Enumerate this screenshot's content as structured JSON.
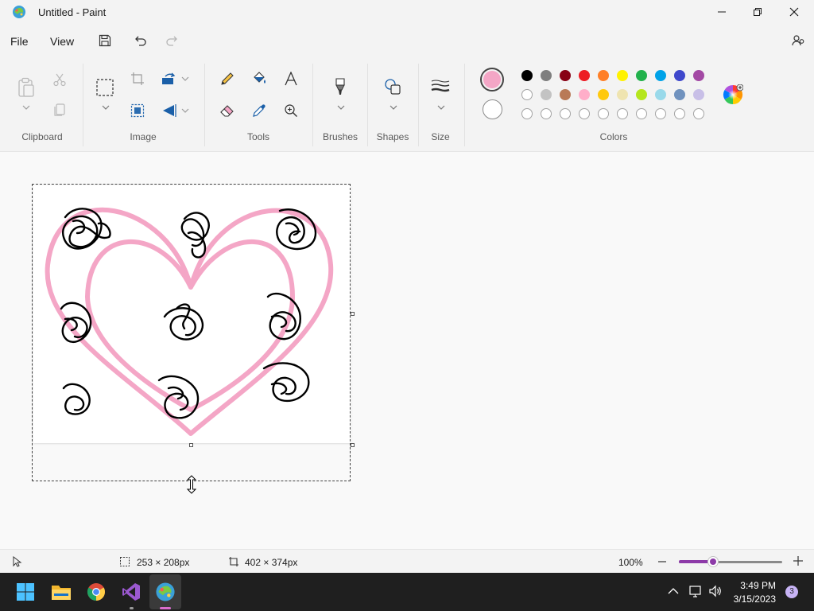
{
  "window": {
    "title": "Untitled - Paint"
  },
  "menu": {
    "file": "File",
    "view": "View"
  },
  "ribbon": {
    "groups": {
      "clipboard": "Clipboard",
      "image": "Image",
      "tools": "Tools",
      "brushes": "Brushes",
      "shapes": "Shapes",
      "size": "Size",
      "colors": "Colors"
    },
    "colors": {
      "primary": "#f4a6c6",
      "secondary": "#ffffff",
      "palette_row1": [
        "#000000",
        "#7f7f7f",
        "#880015",
        "#ed1c24",
        "#ff7f27",
        "#fff200",
        "#22b14c",
        "#00a2e8",
        "#3f48cc",
        "#a349a4"
      ],
      "palette_row2": [
        "#ffffff",
        "#c3c3c3",
        "#b97a57",
        "#ffaec9",
        "#ffc90e",
        "#efe4b0",
        "#b5e61d",
        "#99d9ea",
        "#7092be",
        "#c8bfe7"
      ]
    }
  },
  "status": {
    "selection_size": "253 × 208px",
    "canvas_size": "402 × 374px",
    "zoom": "100%",
    "zoom_slider_level_percent": 33
  },
  "taskbar": {
    "time": "3:49 PM",
    "date": "3/15/2023",
    "notification_count": "3"
  }
}
